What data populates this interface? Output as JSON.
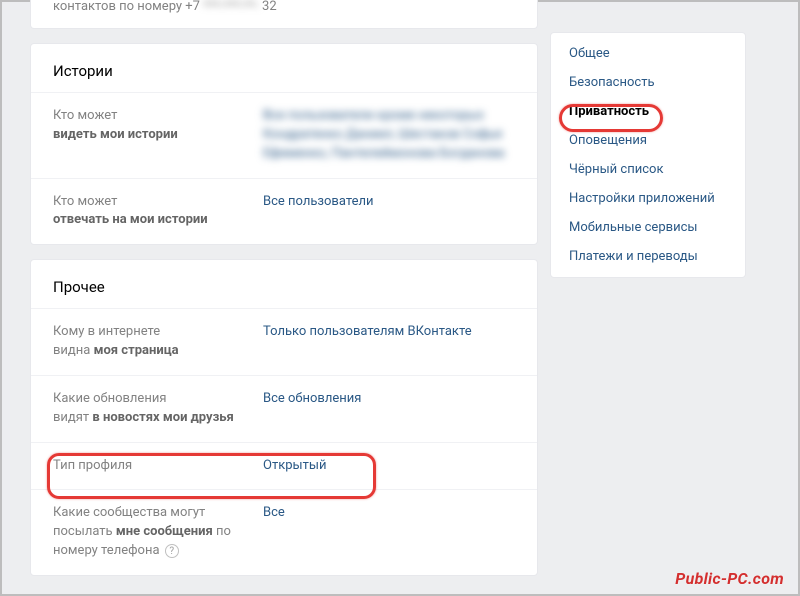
{
  "truncated": {
    "line1_prefix": "контактов по номеру +7",
    "line1_suffix": "32"
  },
  "sections": {
    "stories": {
      "title": "Истории",
      "rows": [
        {
          "label_pre": "Кто может",
          "label_bold": "видеть мои истории"
        },
        {
          "label_pre": "Кто может",
          "label_bold": "отвечать на мои истории",
          "value": "Все пользователи"
        }
      ]
    },
    "other": {
      "title": "Прочее",
      "rows": [
        {
          "label_pre": "Кому в интернете",
          "label_bold_pre": "видна",
          "label_bold": "моя страница",
          "value": "Только пользователям ВКонтакте"
        },
        {
          "label_pre": "Какие обновления",
          "label_mid": "видят",
          "label_bold": "в новостях мои друзья",
          "value": "Все обновления"
        },
        {
          "label_plain": "Тип профиля",
          "value": "Открытый"
        },
        {
          "label_pre": "Какие сообщества могут",
          "label_mid": "посылать",
          "label_bold": "мне сообщения",
          "label_post": "по номеру телефона",
          "help": "?",
          "value": "Все"
        }
      ]
    }
  },
  "sidebar": {
    "items": [
      {
        "label": "Общее"
      },
      {
        "label": "Безопасность"
      },
      {
        "label": "Приватность",
        "active": true
      },
      {
        "label": "Оповещения"
      },
      {
        "label": "Чёрный список"
      },
      {
        "label": "Настройки приложений"
      },
      {
        "label": "Мобильные сервисы"
      },
      {
        "label": "Платежи и переводы"
      }
    ]
  },
  "watermark": "Public-PC.com"
}
